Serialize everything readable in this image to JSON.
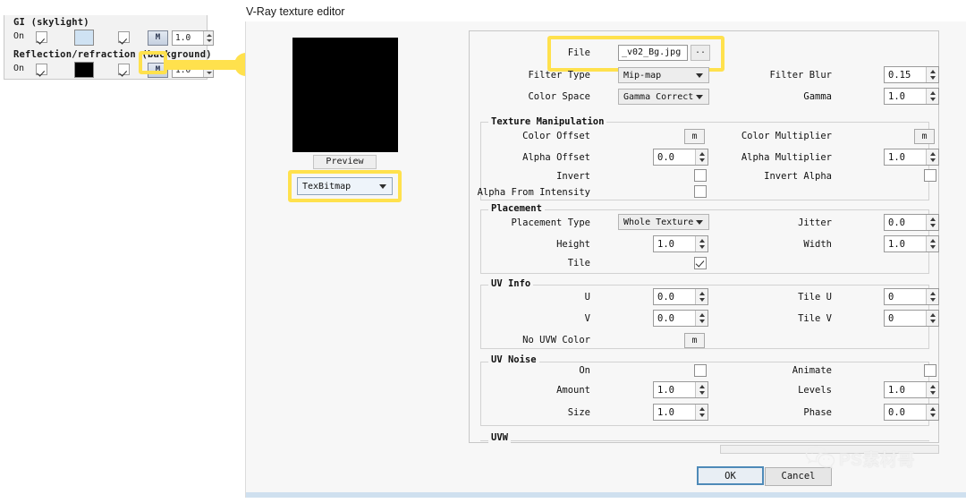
{
  "window": {
    "title": "V-Ray texture editor"
  },
  "left_panel": {
    "gi": {
      "title": "GI (skylight)",
      "on_label": "On",
      "on_checked": true,
      "second_checked": true,
      "swatch_color": "#cfe2f3",
      "map_button": "M",
      "multiplier": "1.0"
    },
    "reflection": {
      "title": "Reflection/refraction (background)",
      "on_label": "On",
      "on_checked": true,
      "second_checked": true,
      "swatch_color": "#000000",
      "map_button": "M",
      "multiplier": "1.0"
    }
  },
  "preview": {
    "button_label": "Preview",
    "texture_type": "TexBitmap",
    "image_color": "#000000"
  },
  "top_settings": {
    "file": {
      "label": "File",
      "value": "_v02_Bg.jpg",
      "browse_label": ".."
    },
    "filter_type": {
      "label": "Filter Type",
      "value": "Mip-map"
    },
    "color_space": {
      "label": "Color Space",
      "value": "Gamma Correct"
    },
    "filter_blur": {
      "label": "Filter Blur",
      "value": "0.15"
    },
    "gamma": {
      "label": "Gamma",
      "value": "1.0"
    }
  },
  "texture_manipulation": {
    "section_label": "Texture Manipulation",
    "color_offset": {
      "label": "Color Offset",
      "button": "m"
    },
    "alpha_offset": {
      "label": "Alpha Offset",
      "value": "0.0"
    },
    "invert": {
      "label": "Invert",
      "checked": false
    },
    "alpha_from_intensity": {
      "label": "Alpha From Intensity",
      "checked": false
    },
    "color_multiplier": {
      "label": "Color Multiplier",
      "button": "m"
    },
    "alpha_multiplier": {
      "label": "Alpha Multiplier",
      "value": "1.0"
    },
    "invert_alpha": {
      "label": "Invert Alpha",
      "checked": false
    }
  },
  "placement": {
    "section_label": "Placement",
    "placement_type": {
      "label": "Placement Type",
      "value": "Whole Texture"
    },
    "height": {
      "label": "Height",
      "value": "1.0"
    },
    "tile": {
      "label": "Tile",
      "checked": true
    },
    "jitter": {
      "label": "Jitter",
      "value": "0.0"
    },
    "width": {
      "label": "Width",
      "value": "1.0"
    }
  },
  "uv_info": {
    "section_label": "UV Info",
    "u": {
      "label": "U",
      "value": "0.0"
    },
    "v": {
      "label": "V",
      "value": "0.0"
    },
    "no_uvw_color": {
      "label": "No UVW Color",
      "button": "m"
    },
    "tile_u": {
      "label": "Tile U",
      "value": "0"
    },
    "tile_v": {
      "label": "Tile V",
      "value": "0"
    }
  },
  "uv_noise": {
    "section_label": "UV Noise",
    "on": {
      "label": "On",
      "checked": false
    },
    "amount": {
      "label": "Amount",
      "value": "1.0"
    },
    "size": {
      "label": "Size",
      "value": "1.0"
    },
    "animate": {
      "label": "Animate",
      "checked": false
    },
    "levels": {
      "label": "Levels",
      "value": "1.0"
    },
    "phase": {
      "label": "Phase",
      "value": "0.0"
    }
  },
  "uvw": {
    "section_label": "UVW"
  },
  "footer": {
    "ok_label": "OK",
    "cancel_label": "Cancel"
  },
  "watermark": {
    "text": "PS素材哥"
  },
  "colors": {
    "highlight": "#ffe14d",
    "accent": "#4e8ab8"
  }
}
